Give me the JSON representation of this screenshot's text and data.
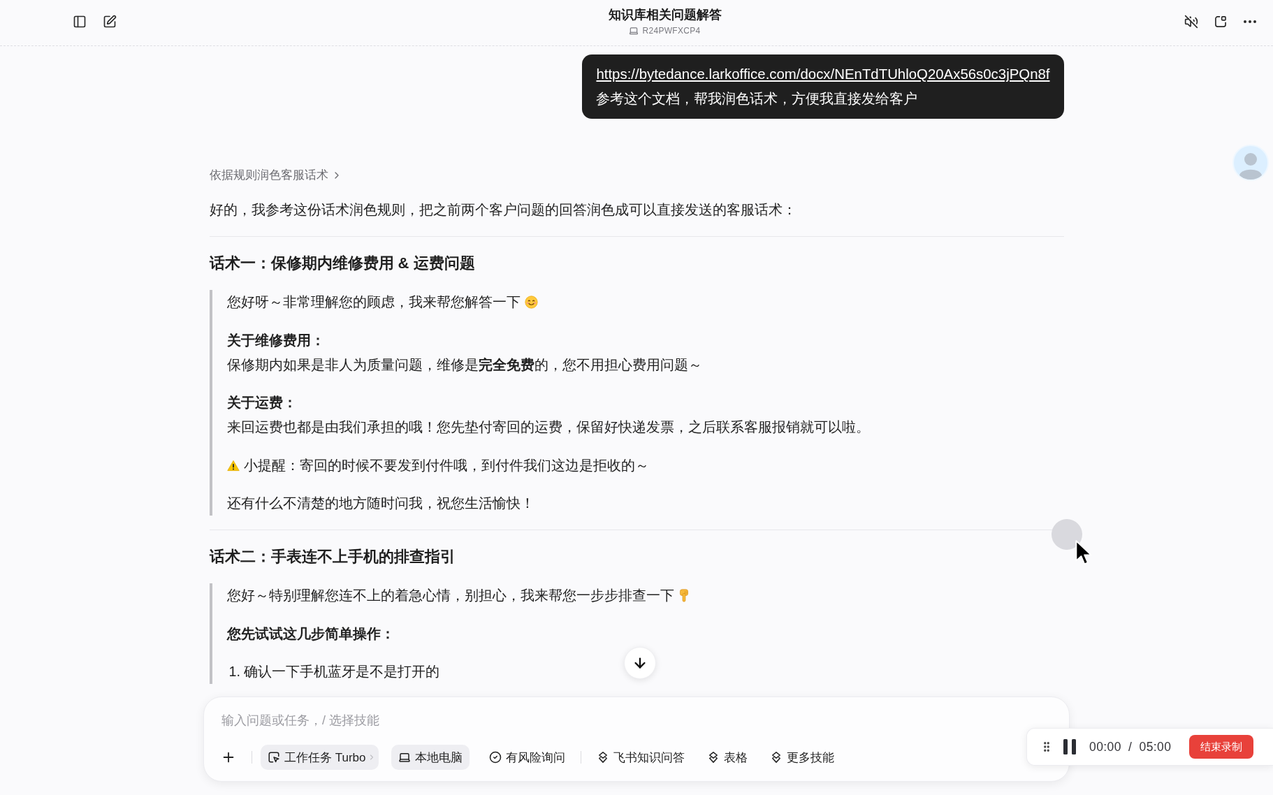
{
  "window": {
    "title": "知识库相关问题解答",
    "device": "R24PWFXCP4"
  },
  "chat": {
    "user_message": {
      "link": "https://bytedance.larkoffice.com/docx/NEnTdTUhloQ20Ax56s0c3jPQn8f",
      "text": "参考这个文档，帮我润色话术，方便我直接发给客户"
    },
    "reply": {
      "skill_trace": "依据规则润色客服话术",
      "intro": "好的，我参考这份话术润色规则，把之前两个客户问题的回答润色成可以直接发送的客服话术：",
      "sections": [
        {
          "title": "话术一：保修期内维修费用 & 运费问题",
          "quote": [
            {
              "kind": "smiling",
              "text": "您好呀～非常理解您的顾虑，我来帮您解答一下"
            },
            {
              "kind": "labeled",
              "label": "关于维修费用：",
              "text": "保修期内如果是非人为质量问题，维修是**完全免费**的，您不用担心费用问题～"
            },
            {
              "kind": "labeled",
              "label": "关于运费：",
              "text": "来回运费也都是由我们承担的哦！您先垫付寄回的运费，保留好快递发票，之后联系客服报销就可以啦。"
            },
            {
              "kind": "warning",
              "text": "小提醒：寄回的时候不要发到付件哦，到付件我们这边是拒收的～"
            },
            {
              "kind": "text",
              "text": "还有什么不清楚的地方随时问我，祝您生活愉快！"
            }
          ]
        },
        {
          "title": "话术二：手表连不上手机的排查指引",
          "quote": [
            {
              "kind": "pointing",
              "text": "您好～特别理解您连不上的着急心情，别担心，我来帮您一步步排查一下"
            },
            {
              "kind": "label",
              "text": "您先试试这几步简单操作："
            },
            {
              "kind": "step",
              "text": "1. 确认一下手机蓝牙是不是打开的"
            }
          ]
        }
      ]
    }
  },
  "composer": {
    "placeholder": "输入问题或任务，/ 选择技能",
    "modes": [
      {
        "kind": "task",
        "label": "工作任务 Turbo",
        "selected": true,
        "dropdown": true
      },
      {
        "kind": "device",
        "label": "本地电脑",
        "selected": true,
        "dropdown": false
      },
      {
        "kind": "confirm",
        "label": "有风险询问",
        "selected": false,
        "dropdown": false
      }
    ],
    "skills": [
      {
        "label": "飞书知识问答"
      },
      {
        "label": "表格"
      },
      {
        "label": "更多技能"
      }
    ]
  },
  "recorder": {
    "time": "00:00 / 05:00",
    "stop_button": "结束录制"
  }
}
